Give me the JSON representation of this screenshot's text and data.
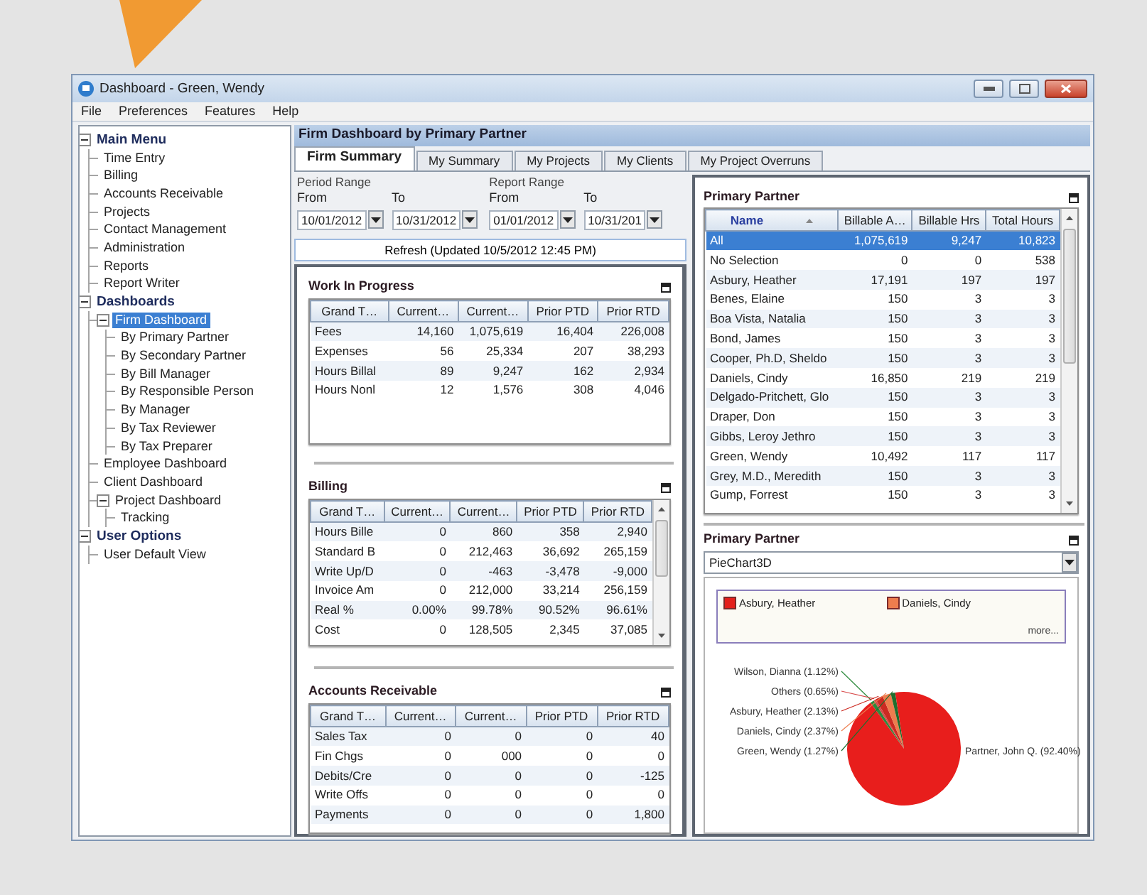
{
  "window": {
    "title": "Dashboard - Green, Wendy"
  },
  "menu": [
    "File",
    "Preferences",
    "Features",
    "Help"
  ],
  "tree": [
    {
      "label": "Main Menu",
      "expanded": true,
      "selected": false,
      "children": [
        {
          "label": "Time Entry",
          "selected": false
        },
        {
          "label": "Billing",
          "selected": false
        },
        {
          "label": "Accounts Receivable",
          "selected": false
        },
        {
          "label": "Projects",
          "selected": false
        },
        {
          "label": "Contact Management",
          "selected": false
        },
        {
          "label": "Administration",
          "selected": false
        },
        {
          "label": "Reports",
          "selected": false
        },
        {
          "label": "Report Writer",
          "selected": false
        }
      ]
    },
    {
      "label": "Dashboards",
      "expanded": true,
      "selected": false,
      "children": [
        {
          "label": "Firm Dashboard",
          "expanded": true,
          "selected": true,
          "children": [
            {
              "label": "By Primary Partner",
              "selected": false
            },
            {
              "label": "By Secondary Partner",
              "selected": false
            },
            {
              "label": "By Bill Manager",
              "selected": false
            },
            {
              "label": "By Responsible Person",
              "selected": false
            },
            {
              "label": "By Manager",
              "selected": false
            },
            {
              "label": "By Tax Reviewer",
              "selected": false
            },
            {
              "label": "By Tax Preparer",
              "selected": false
            }
          ]
        },
        {
          "label": "Employee Dashboard",
          "selected": false
        },
        {
          "label": "Client Dashboard",
          "selected": false
        },
        {
          "label": "Project Dashboard",
          "expanded": true,
          "selected": false,
          "children": [
            {
              "label": "Tracking",
              "selected": false
            }
          ]
        }
      ]
    },
    {
      "label": "User Options",
      "expanded": true,
      "selected": false,
      "children": [
        {
          "label": "User Default View",
          "selected": false
        }
      ]
    }
  ],
  "header": {
    "title": "Firm Dashboard by Primary Partner"
  },
  "tabs": [
    {
      "label": "Firm Summary",
      "selected": true
    },
    {
      "label": "My Summary",
      "selected": false
    },
    {
      "label": "My Projects",
      "selected": false
    },
    {
      "label": "My Clients",
      "selected": false
    },
    {
      "label": "My Project Overruns",
      "selected": false
    }
  ],
  "ranges": [
    {
      "title": "Period Range",
      "from_label": "From",
      "to_label": "To",
      "from": "10/01/2012",
      "to": "10/31/2012"
    },
    {
      "title": "Report Range",
      "from_label": "From",
      "to_label": "To",
      "from": "01/01/2012",
      "to": "10/31/201"
    }
  ],
  "refresh_button": "Refresh (Updated 10/5/2012 12:45 PM)",
  "panels": [
    {
      "title": "Work In Progress",
      "scrollbar": false,
      "columns": [
        "Grand T…",
        "Current…",
        "Current…",
        "Prior PTD",
        "Prior RTD"
      ],
      "rows": [
        [
          "Fees",
          "14,160",
          "1,075,619",
          "16,404",
          "226,008"
        ],
        [
          "Expenses",
          "56",
          "25,334",
          "207",
          "38,293"
        ],
        [
          "Hours Billal",
          "89",
          "9,247",
          "162",
          "2,934"
        ],
        [
          "Hours Nonl",
          "12",
          "1,576",
          "308",
          "4,046"
        ]
      ]
    },
    {
      "title": "Billing",
      "scrollbar": true,
      "columns": [
        "Grand T…",
        "Current…",
        "Current…",
        "Prior PTD",
        "Prior RTD"
      ],
      "rows": [
        [
          "Hours Bille",
          "0",
          "860",
          "358",
          "2,940"
        ],
        [
          "Standard B",
          "0",
          "212,463",
          "36,692",
          "265,159"
        ],
        [
          "Write Up/D",
          "0",
          "-463",
          "-3,478",
          "-9,000"
        ],
        [
          "Invoice Am",
          "0",
          "212,000",
          "33,214",
          "256,159"
        ],
        [
          "Real %",
          "0.00%",
          "99.78%",
          "90.52%",
          "96.61%"
        ],
        [
          "Cost",
          "0",
          "128,505",
          "2,345",
          "37,085"
        ]
      ]
    },
    {
      "title": "Accounts Receivable",
      "scrollbar": false,
      "columns": [
        "Grand T…",
        "Current…",
        "Current…",
        "Prior PTD",
        "Prior RTD"
      ],
      "rows": [
        [
          "Sales Tax",
          "0",
          "0",
          "0",
          "40"
        ],
        [
          "Fin Chgs",
          "0",
          "000",
          "0",
          "0"
        ],
        [
          "Debits/Cre",
          "0",
          "0",
          "0",
          "-125"
        ],
        [
          "Write Offs",
          "0",
          "0",
          "0",
          "0"
        ],
        [
          "Payments",
          "0",
          "0",
          "0",
          "1,800"
        ]
      ]
    }
  ],
  "partner_grid": {
    "title": "Primary Partner",
    "columns": [
      "Name",
      "Billable A…",
      "Billable Hrs",
      "Total Hours"
    ],
    "rows": [
      {
        "cells": [
          "All",
          "1,075,619",
          "9,247",
          "10,823"
        ],
        "selected": true
      },
      {
        "cells": [
          "No Selection",
          "0",
          "0",
          "538"
        ],
        "selected": false
      },
      {
        "cells": [
          "Asbury, Heather",
          "17,191",
          "197",
          "197"
        ],
        "selected": false
      },
      {
        "cells": [
          "Benes, Elaine",
          "150",
          "3",
          "3"
        ],
        "selected": false
      },
      {
        "cells": [
          "Boa Vista, Natalia",
          "150",
          "3",
          "3"
        ],
        "selected": false
      },
      {
        "cells": [
          "Bond, James",
          "150",
          "3",
          "3"
        ],
        "selected": false
      },
      {
        "cells": [
          "Cooper, Ph.D, Sheldo",
          "150",
          "3",
          "3"
        ],
        "selected": false
      },
      {
        "cells": [
          "Daniels, Cindy",
          "16,850",
          "219",
          "219"
        ],
        "selected": false
      },
      {
        "cells": [
          "Delgado-Pritchett, Glo",
          "150",
          "3",
          "3"
        ],
        "selected": false
      },
      {
        "cells": [
          "Draper, Don",
          "150",
          "3",
          "3"
        ],
        "selected": false
      },
      {
        "cells": [
          "Gibbs, Leroy Jethro",
          "150",
          "3",
          "3"
        ],
        "selected": false
      },
      {
        "cells": [
          "Green, Wendy",
          "10,492",
          "117",
          "117"
        ],
        "selected": false
      },
      {
        "cells": [
          "Grey, M.D., Meredith",
          "150",
          "3",
          "3"
        ],
        "selected": false
      },
      {
        "cells": [
          "Gump, Forrest",
          "150",
          "3",
          "3"
        ],
        "selected": false
      }
    ]
  },
  "chart_panel": {
    "title": "Primary Partner",
    "chart_type": "PieChart3D",
    "legend": [
      {
        "label": "Asbury, Heather",
        "color": "#e3201c"
      },
      {
        "label": "Daniels, Cindy",
        "color": "#ee7d4e"
      }
    ],
    "legend_more": "more...",
    "chart_data": {
      "type": "pie",
      "categories": [
        "Wilson, Dianna",
        "Others",
        "Asbury, Heather",
        "Daniels, Cindy",
        "Green, Wendy",
        "Partner, John Q."
      ],
      "values": [
        1.12,
        0.65,
        2.13,
        2.37,
        1.27,
        92.4
      ],
      "value_labels": [
        "(1.12%)",
        "(0.65%)",
        "(2.13%)",
        "(2.37%)",
        "(1.27%)",
        "(92.40%)"
      ]
    }
  }
}
